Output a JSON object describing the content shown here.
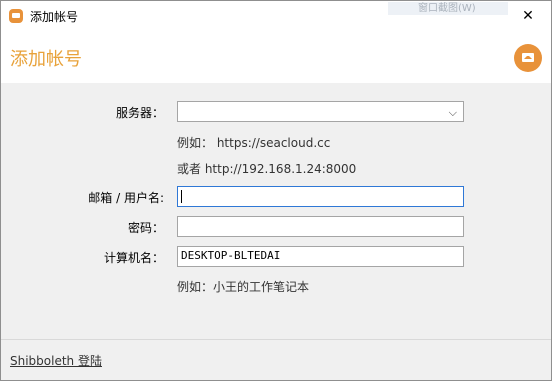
{
  "window": {
    "title": "添加帐号",
    "ghost_menu": "窗口截图(W)",
    "close_glyph": "✕"
  },
  "header": {
    "title": "添加帐号"
  },
  "form": {
    "server": {
      "label": "服务器：",
      "value": "",
      "example": "例如： https://seacloud.cc",
      "alt_example": "或者 http://192.168.1.24:8000"
    },
    "email": {
      "label": "邮箱 / 用户名:",
      "value": ""
    },
    "password": {
      "label": "密码：",
      "value": ""
    },
    "computer_name": {
      "label": "计算机名：",
      "value": "DESKTOP-BLTEDAI",
      "example": "例如：小王的工作笔记本"
    }
  },
  "footer": {
    "shibboleth_link": "Shibboleth 登陆"
  },
  "icons": {
    "app": "seafile-app-icon",
    "logo": "seafile-logo-icon",
    "dropdown": "chevron-down-icon"
  },
  "colors": {
    "accent": "#e8a23a",
    "logo": "#e8923a",
    "focus_border": "#2f78d6",
    "form_bg": "#f0f0f0"
  }
}
